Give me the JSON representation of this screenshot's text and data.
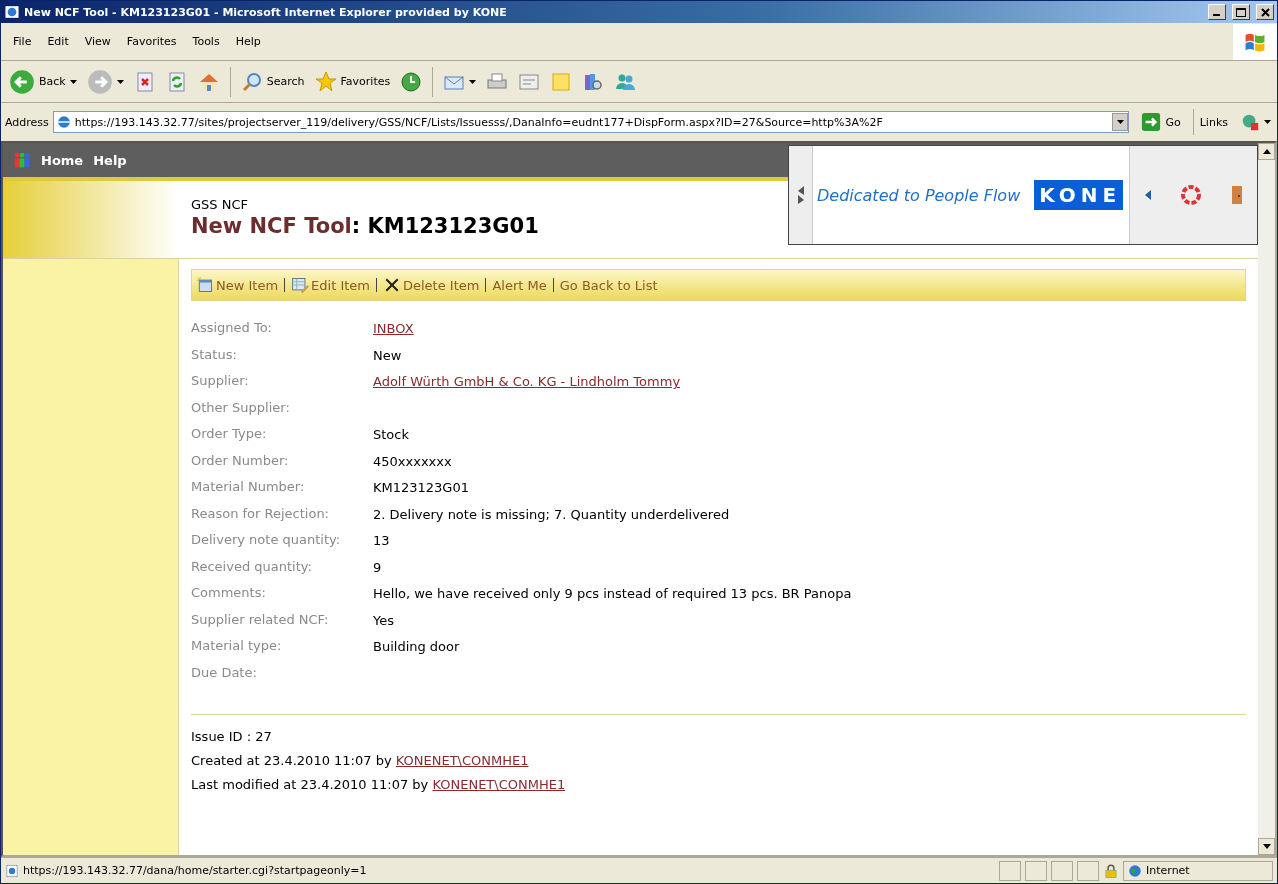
{
  "window": {
    "title": "New NCF Tool - KM123123G01 - Microsoft Internet Explorer provided by KONE"
  },
  "menu": [
    "File",
    "Edit",
    "View",
    "Favorites",
    "Tools",
    "Help"
  ],
  "toolbar": {
    "back": "Back",
    "search": "Search",
    "favorites": "Favorites"
  },
  "address": {
    "label": "Address",
    "url": "https://193.143.32.77/sites/projectserver_119/delivery/GSS/NCF/Lists/Issuesss/,DanaInfo=eudnt177+DispForm.aspx?ID=27&Source=http%3A%2F",
    "go": "Go",
    "links": "Links"
  },
  "nav": [
    "Home",
    "Help"
  ],
  "banner": {
    "tagline": "Dedicated to People Flow",
    "logo": "KONE"
  },
  "header": {
    "site": "GSS NCF",
    "list": "New NCF Tool",
    "item": ": KM123123G01"
  },
  "actions": [
    {
      "kind": "new",
      "label": "New Item"
    },
    {
      "kind": "edit",
      "label": "Edit Item"
    },
    {
      "kind": "delete",
      "label": "Delete Item"
    },
    {
      "kind": "plain",
      "label": "Alert Me"
    },
    {
      "kind": "plain",
      "label": "Go Back to List"
    }
  ],
  "fields": [
    {
      "label": "Assigned To:",
      "kind": "link",
      "value": "INBOX"
    },
    {
      "label": "Status:",
      "kind": "text",
      "value": "New"
    },
    {
      "label": "Supplier:",
      "kind": "link",
      "value": "Adolf Würth GmbH & Co. KG - Lindholm Tommy"
    },
    {
      "label": "Other Supplier:"
    },
    {
      "label": "Order Type:",
      "kind": "text",
      "value": "Stock"
    },
    {
      "label": "Order Number:",
      "kind": "text",
      "value": "450xxxxxxx"
    },
    {
      "label": "Material Number:",
      "kind": "text",
      "value": "KM123123G01"
    },
    {
      "label": "Reason for Rejection:",
      "kind": "text",
      "value": "2. Delivery note is missing; 7. Quantity underdelivered"
    },
    {
      "label": "Delivery note quantity:",
      "kind": "text",
      "value": "13"
    },
    {
      "label": "Received quantity:",
      "kind": "text",
      "value": "9"
    },
    {
      "label": "Comments:",
      "kind": "text",
      "value": "Hello, we have received only 9 pcs instead of required 13 pcs. BR Panopa"
    },
    {
      "label": "Supplier related NCF:",
      "kind": "text",
      "value": "Yes"
    },
    {
      "label": "Material type:",
      "kind": "text",
      "value": "Building door"
    },
    {
      "label": "Due Date:"
    }
  ],
  "footer": [
    {
      "text": "Issue ID : 27"
    },
    {
      "text": "Created at 23.4.2010 11:07 by ",
      "link": "KONENET\\CONMHE1"
    },
    {
      "text": "Last modified at 23.4.2010 11:07 by ",
      "link": "KONENET\\CONMHE1"
    }
  ],
  "status_bar": {
    "url": "https://193.143.32.77/dana/home/starter.cgi?startpageonly=1",
    "zone": "Internet"
  }
}
